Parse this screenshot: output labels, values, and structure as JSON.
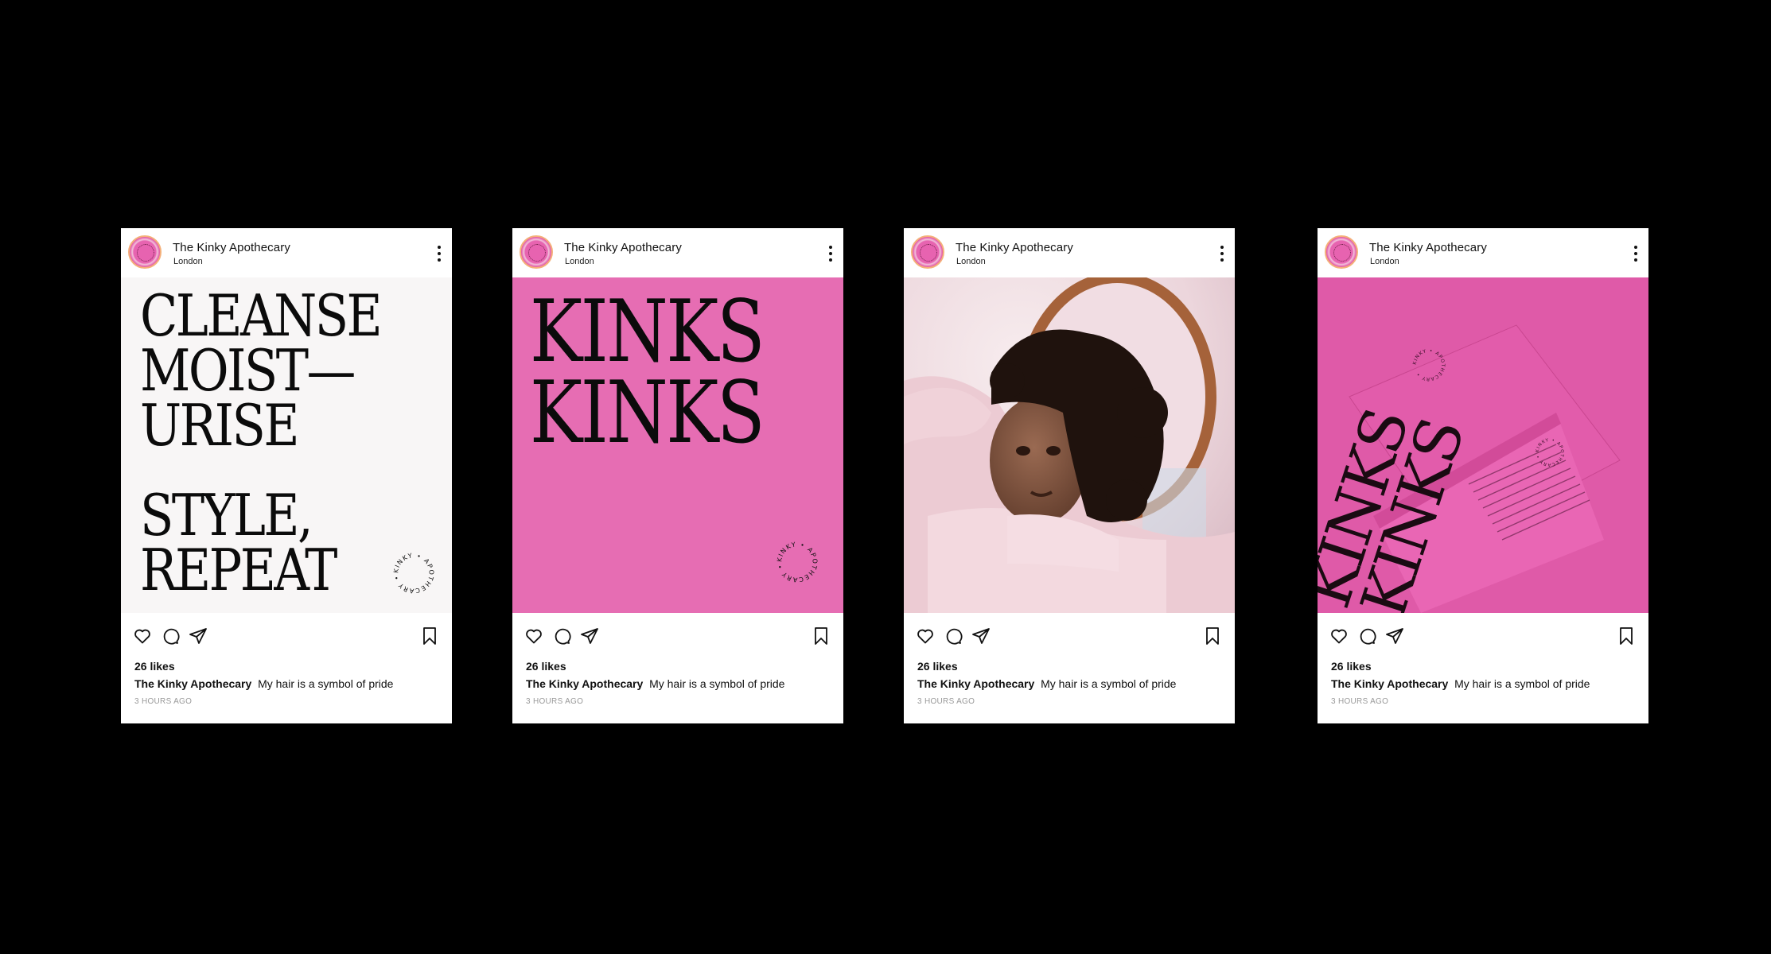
{
  "accent_colors": {
    "pink": "#e66db3",
    "pink_deep": "#df5aa8",
    "background": "#000000"
  },
  "posts": [
    {
      "account_name": "The Kinky Apothecary",
      "location": "London",
      "headline_1": "CLEANSE\nMOIST—\nURISE",
      "headline_2": "STYLE,\nREPEAT",
      "seal_text": "KINKY APOTHECARY",
      "likes": "26 likes",
      "caption_author": "The Kinky Apothecary",
      "caption_text": "My hair is a symbol of pride",
      "time": "3 HOURS AGO"
    },
    {
      "account_name": "The Kinky Apothecary",
      "location": "London",
      "headline": "KINKS\nKINKS",
      "seal_text": "KINKY APOTHECARY",
      "likes": "26 likes",
      "caption_author": "The Kinky Apothecary",
      "caption_text": "My hair is a symbol of pride",
      "time": "3 HOURS AGO"
    },
    {
      "account_name": "The Kinky Apothecary",
      "location": "London",
      "likes": "26 likes",
      "caption_author": "The Kinky Apothecary",
      "caption_text": "My hair is a symbol of pride",
      "time": "3 HOURS AGO"
    },
    {
      "account_name": "The Kinky Apothecary",
      "location": "London",
      "package_wordmark": "KINKS\nKINKS",
      "seal_text": "KINKY APOTHECARY",
      "likes": "26 likes",
      "caption_author": "The Kinky Apothecary",
      "caption_text": "My hair is a symbol of pride",
      "time": "3 HOURS AGO"
    }
  ],
  "icons": {
    "like": "heart-icon",
    "comment": "comment-icon",
    "share": "share-icon",
    "save": "bookmark-icon",
    "more": "more-vertical-icon"
  }
}
